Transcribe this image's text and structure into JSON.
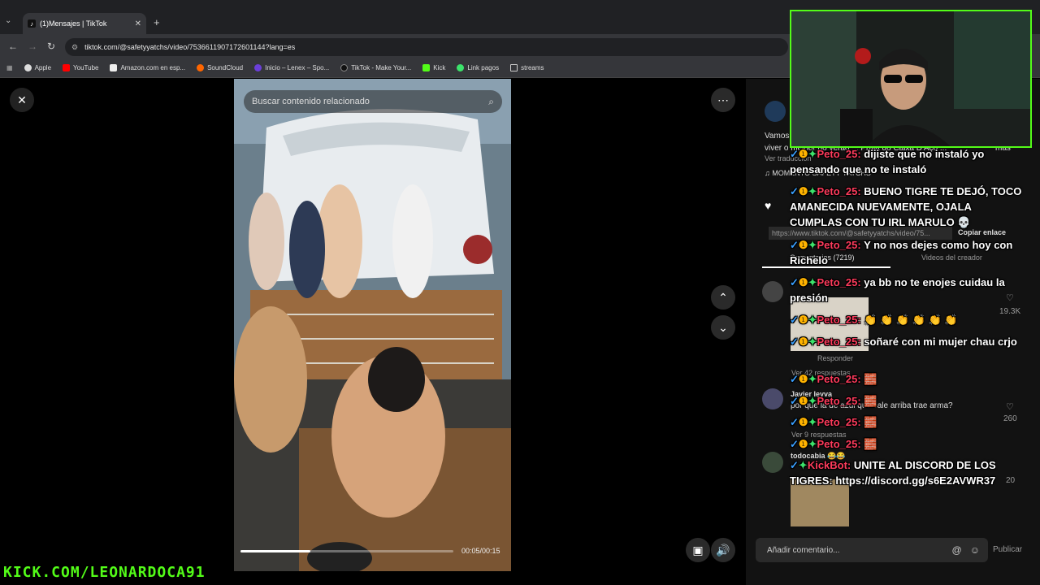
{
  "browser": {
    "tab_title": "(1)Mensajes | TikTok",
    "url": "tiktok.com/@safetyyatchs/video/7536611907172601144?lang=es",
    "bookmarks": [
      "Apple",
      "YouTube",
      "Amazon.com en esp...",
      "SoundCloud",
      "Inicio – Lenex – Spo...",
      "TikTok - Make Your...",
      "Kick",
      "Link pagos",
      "streams"
    ]
  },
  "video": {
    "search_placeholder": "Buscar contenido relacionado",
    "time": "00:05/00:15",
    "progress": 0.33
  },
  "panel": {
    "caption_start": "Vamos",
    "caption_line2": "viver o melhor do verão ... Praia do Caixa D'Aço ...",
    "caption_more": "más",
    "see_translation": "Ver traducción",
    "music": "♫ MOMENTO SAFETY YATCHS",
    "link": "https://www.tiktok.com/@safetyyatchs/video/75...",
    "copy_link": "Copiar enlace",
    "tab_comments": "Comentarios (7219)",
    "tab_creator": "Videos del creador",
    "comments": [
      {
        "likes": "19.3K",
        "reply": "Responder",
        "view": "Ver 42 respuestas"
      },
      {
        "user": "Javier leyva",
        "text": "por que la de azul que sale arriba trae arma?",
        "likes": "260",
        "view": "Ver 9 respuestas"
      },
      {
        "user": "todocabia 😂😂",
        "likes": "20"
      }
    ],
    "add_comment": "Añadir comentario...",
    "publish": "Publicar"
  },
  "chat": [
    {
      "user": "Peto_25:",
      "text": "dijiste que no instaló yo pensando que no te instaló"
    },
    {
      "user": "Peto_25:",
      "text": "BUENO TIGRE TE DEJÓ, TOCO AMANECIDA NUEVAMENTE, OJALA CUMPLAS CON TU IRL MARULO 💀"
    },
    {
      "user": "Peto_25:",
      "text": "Y no nos dejes como hoy con Richelo"
    },
    {
      "user": "Peto_25:",
      "text": "ya bb no te enojes cuidau la presión"
    },
    {
      "user": "Peto_25:",
      "text": "👏 👏 👏 👏 👏 👏"
    },
    {
      "user": "Peto_25:",
      "text": "soñaré con mi mujer chau crjo"
    },
    {
      "user": "Peto_25:",
      "text": "🧱"
    },
    {
      "user": "Peto_25:",
      "text": "🧱"
    },
    {
      "user": "Peto_25:",
      "text": "🧱"
    },
    {
      "user": "Peto_25:",
      "text": "🧱"
    },
    {
      "user": "KickBot:",
      "text": "UNITE AL DISCORD DE LOS TIGRES: https://discord.gg/s6E2AVWR37"
    }
  ],
  "overlay": {
    "kick_url": "KICK.COM/LEONARDOCA91"
  },
  "colors": {
    "kick_green": "#53fc18",
    "chat_user": "#ff3b5c"
  }
}
